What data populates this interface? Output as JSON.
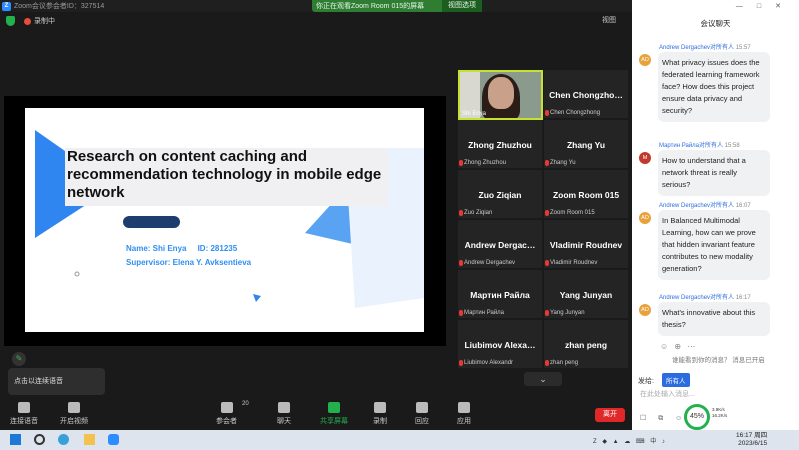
{
  "window": {
    "title": "Zoom会议参会者ID：327514",
    "share_banner": "你正在观看Zoom Room 015的屏幕",
    "view_options": "视图选项",
    "recording_label": "录制中",
    "view_label": "视图"
  },
  "slide": {
    "title": "Research on content caching and recommendation technology in mobile edge network",
    "name_line": "Name: Shi Enya     ID: 281235",
    "supervisor_line": "Supervisor: Elena Y. Avksentieva"
  },
  "gallery": {
    "active": {
      "label": "Shi Enya"
    },
    "tiles": [
      {
        "name": "Chen  Chongzho…",
        "sub": "Chen Chongzhong"
      },
      {
        "name": "Zhong Zhuzhou",
        "sub": "Zhong Zhuzhou"
      },
      {
        "name": "Zhang Yu",
        "sub": "Zhang Yu"
      },
      {
        "name": "Zuo Ziqian",
        "sub": "Zuo Ziqian"
      },
      {
        "name": "Zoom Room 015",
        "sub": "Zoom Room 015"
      },
      {
        "name": "Andrew  Dergac…",
        "sub": "Andrew Dergachev"
      },
      {
        "name": "Vladimir Roudnev",
        "sub": "Vladimir Roudnev"
      },
      {
        "name": "Мартин Райла",
        "sub": "Мартин Райла"
      },
      {
        "name": "Yang Junyan",
        "sub": "Yang Junyan"
      },
      {
        "name": "Liubimov  Alexa…",
        "sub": "Liubimov Alexandr"
      },
      {
        "name": "zhan peng",
        "sub": "zhan peng"
      }
    ]
  },
  "tooltip": "点击以连续语音",
  "toolbar": {
    "audio": "连接语音",
    "video": "开启视频",
    "participants": "参会者",
    "participant_count": "20",
    "chat": "聊天",
    "share": "共享屏幕",
    "record": "录制",
    "reactions": "回应",
    "apps": "应用",
    "leave": "离开"
  },
  "chat": {
    "header": "会议聊天",
    "messages": [
      {
        "avatar": "AD",
        "avatar_color": "#e9a23b",
        "from": "Andrew Dergachev对所有人",
        "time": "15:57",
        "text": "What privacy issues does the federated learning framework face? How does this project ensure data privacy and security?"
      },
      {
        "avatar": "M",
        "avatar_color": "#c0392b",
        "from": "Мартин Райла对所有人",
        "time": "15:58",
        "text": "How to understand that a network threat is really serious?"
      },
      {
        "avatar": "AD",
        "avatar_color": "#e9a23b",
        "from": "Andrew Dergachev对所有人",
        "time": "16:07",
        "text": "In Balanced Multimodal Learning, how can we prove that hidden invariant feature contributes to new modality generation?"
      },
      {
        "avatar": "AD",
        "avatar_color": "#e9a23b",
        "from": "Andrew Dergachev对所有人",
        "time": "16:17",
        "text": "What's innovative about this thesis?"
      }
    ],
    "note": "谁能看到你的消息？ 消息已开启",
    "send_to_label": "发给:",
    "recipient": "所有人",
    "input_placeholder": "在此处输入消息..."
  },
  "network": {
    "percent": "45%",
    "up": "3.9K/s",
    "down": "16.2K/s"
  },
  "taskbar": {
    "time": "16:17 周四",
    "date": "2023/6/15"
  }
}
